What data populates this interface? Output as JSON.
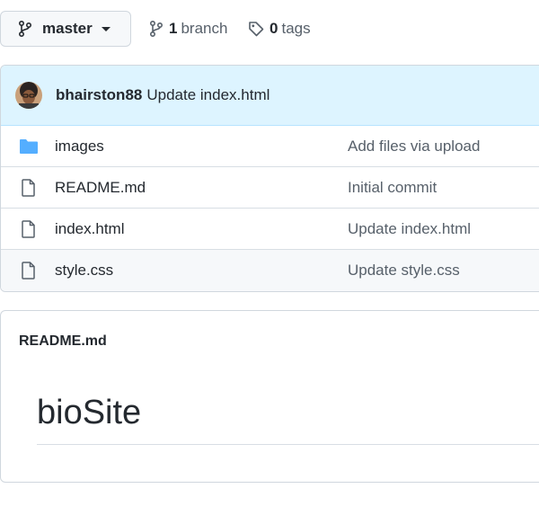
{
  "branch_selector": {
    "label": "master"
  },
  "stats": {
    "branches": {
      "count": "1",
      "label": "branch"
    },
    "tags": {
      "count": "0",
      "label": "tags"
    }
  },
  "latest_commit": {
    "author": "bhairston88",
    "message": "Update index.html"
  },
  "files": [
    {
      "name": "images",
      "type": "folder",
      "commit": "Add files via upload"
    },
    {
      "name": "README.md",
      "type": "file",
      "commit": "Initial commit"
    },
    {
      "name": "index.html",
      "type": "file",
      "commit": "Update index.html"
    },
    {
      "name": "style.css",
      "type": "file",
      "commit": "Update style.css"
    }
  ],
  "readme": {
    "filename": "README.md",
    "heading": "bioSite"
  },
  "colors": {
    "folder": "#54aeff",
    "commit_bar": "#ddf4ff",
    "border": "#d0d7de",
    "muted": "#57606a"
  }
}
